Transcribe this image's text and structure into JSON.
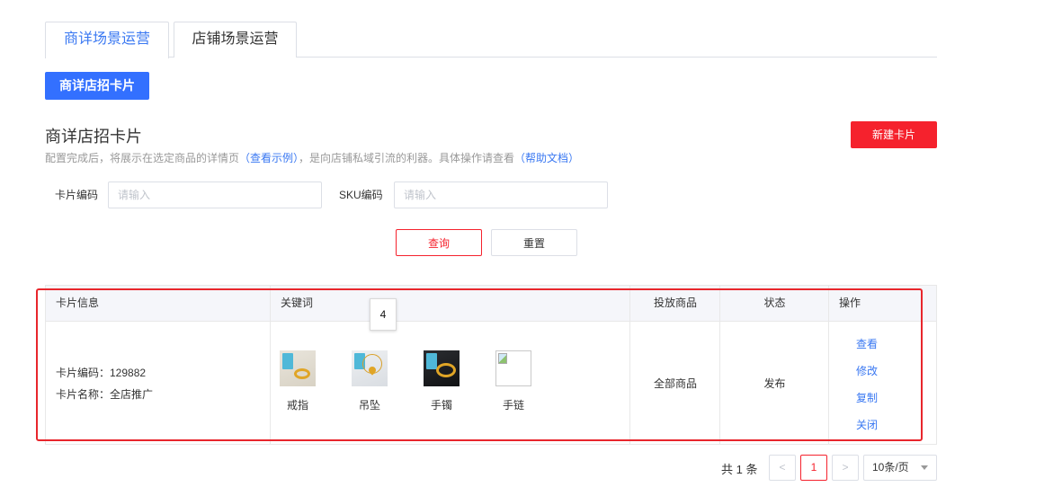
{
  "tabs": [
    {
      "label": "商详场景运营",
      "active": true
    },
    {
      "label": "店铺场景运营",
      "active": false
    }
  ],
  "primary_button": "商详店招卡片",
  "section": {
    "title": "商详店招卡片",
    "desc_prefix": "配置完成后，将展示在选定商品的详情页",
    "desc_link1": "（查看示例）",
    "desc_middle": "，是向店铺私域引流的利器。具体操作请查看",
    "desc_link2": "（帮助文档）"
  },
  "new_button": "新建卡片",
  "filters": {
    "card_code_label": "卡片编码",
    "card_code_placeholder": "请输入",
    "sku_label": "SKU编码",
    "sku_placeholder": "请输入"
  },
  "buttons": {
    "query": "查询",
    "reset": "重置"
  },
  "table": {
    "headers": [
      "卡片信息",
      "关键词",
      "投放商品",
      "状态",
      "操作"
    ],
    "row": {
      "card_code": "卡片编码：129882",
      "card_name": "卡片名称：全店推广",
      "keywords": [
        {
          "name": "戒指",
          "icon": "ring-image"
        },
        {
          "name": "吊坠",
          "icon": "pendant-image"
        },
        {
          "name": "手镯",
          "icon": "bracelet-image"
        },
        {
          "name": "手链",
          "icon": "broken-image"
        }
      ],
      "products": "全部商品",
      "status": "发布",
      "ops": [
        "查看",
        "修改",
        "复制",
        "关闭"
      ]
    }
  },
  "overlay_badge": "4",
  "pagination": {
    "total": "共 1 条",
    "prev": "<",
    "current": "1",
    "next": ">",
    "page_size": "10条/页"
  },
  "colors": {
    "accent_blue": "#3370ff",
    "link_blue": "#3a78f2",
    "danger_red": "#f5222d",
    "highlight_frame": "#e8262c"
  }
}
